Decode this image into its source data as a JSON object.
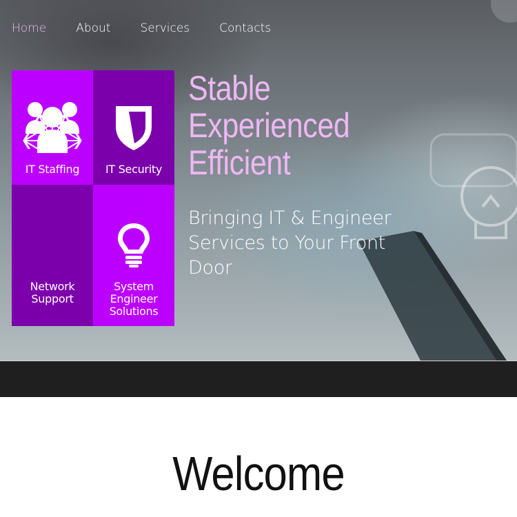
{
  "nav": {
    "items": [
      {
        "label": "Home",
        "active": true
      },
      {
        "label": "About",
        "active": false
      },
      {
        "label": "Services",
        "active": false
      },
      {
        "label": "Contacts",
        "active": false
      }
    ]
  },
  "tiles": [
    {
      "label": "IT Staffing",
      "icon": "users-icon"
    },
    {
      "label": "IT Security",
      "icon": "shield-icon"
    },
    {
      "label_lines": [
        "Network",
        "Support"
      ],
      "icon": "network-icon"
    },
    {
      "label_lines": [
        "System",
        "Engineer",
        "Solutions"
      ],
      "icon": "lightbulb-icon"
    }
  ],
  "hero": {
    "headline": [
      "Stable",
      "Experienced",
      "Efficient"
    ],
    "subline": [
      "Bringing IT & Engineer",
      "Services to Your Front",
      "Door"
    ]
  },
  "welcome": {
    "title": "Welcome"
  },
  "colors": {
    "accent_bright": "#bb00ff",
    "accent_dark": "#7b00ab",
    "headline": "#efb7f5",
    "nav_active": "#ecb8f4",
    "band": "#1f1f1f"
  }
}
